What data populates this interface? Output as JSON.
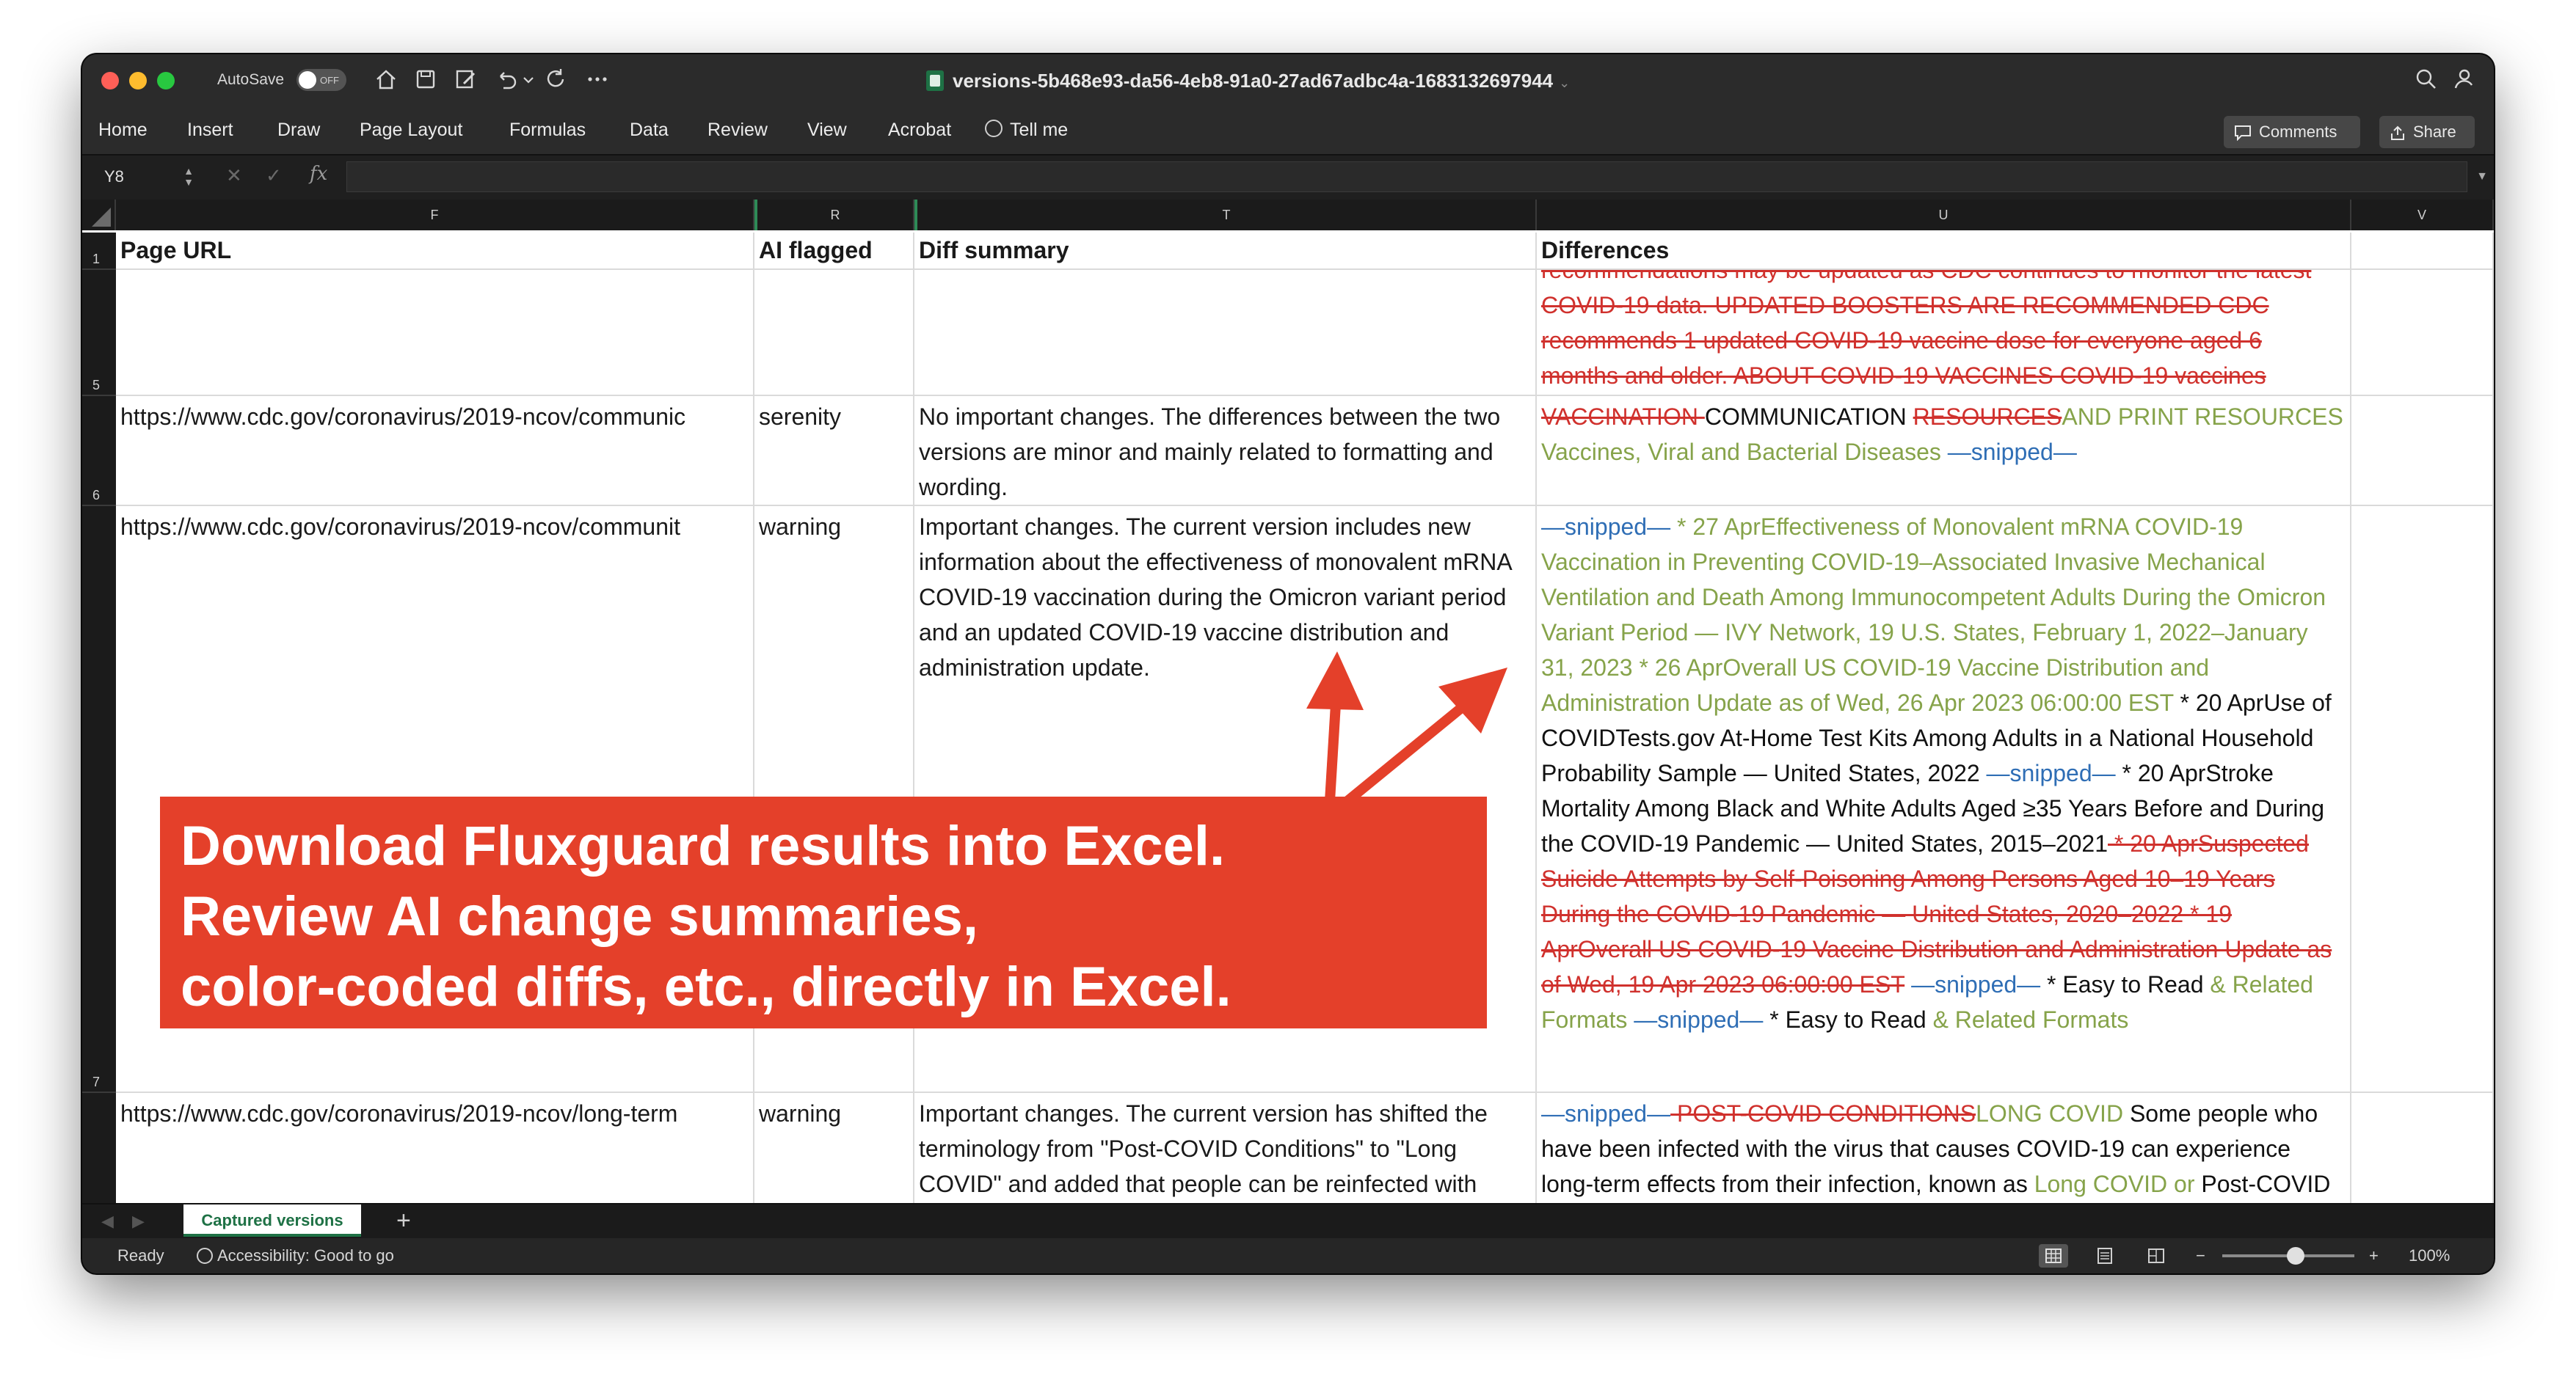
{
  "window": {
    "autosave_label": "AutoSave",
    "autosave_state": "OFF",
    "file_name": "versions-5b468e93-da56-4eb8-91a0-27ad67adbc4a-1683132697944"
  },
  "ribbon": {
    "tabs": [
      "Home",
      "Insert",
      "Draw",
      "Page Layout",
      "Formulas",
      "Data",
      "Review",
      "View",
      "Acrobat"
    ],
    "tell_me": "Tell me",
    "comments_label": "Comments",
    "share_label": "Share"
  },
  "formula_bar": {
    "cell_ref": "Y8",
    "fx_label": "fx",
    "value": ""
  },
  "columns": [
    "F",
    "R",
    "T",
    "U",
    "V"
  ],
  "rows_numbers": [
    "1",
    "5",
    "6",
    "7"
  ],
  "header_row": {
    "page_url": "Page URL",
    "ai_flagged": "AI flagged",
    "diff_summary": "Diff summary",
    "differences": "Differences"
  },
  "row5": {
    "lines": [
      "recommendations may be updated as CDC continues to monitor the latest",
      "COVID-19 data.  UPDATED BOOSTERS ARE RECOMMENDED  CDC",
      "recommends 1 updated COVID-19 vaccine dose for everyone aged 6",
      "months and older.  ABOUT COVID-19 VACCINES  COVID-19 vaccines"
    ]
  },
  "row6": {
    "url": "https://www.cdc.gov/coronavirus/2019-ncov/communic",
    "flag": "serenity",
    "summary": "No important changes. The differences between the two versions are minor and mainly related to formatting and wording.",
    "diff": {
      "d1": "VACCINATION ",
      "d2": "COMMUNICATION ",
      "d3": "RESOURCES",
      "d4": "AND PRINT RESOURCES",
      "d5": "Vaccines, Viral and Bacterial Diseases ",
      "d6": "—snipped—"
    }
  },
  "row7": {
    "url": "https://www.cdc.gov/coronavirus/2019-ncov/communit",
    "flag": "warning",
    "summary": "Important changes. The current version includes new information about the effectiveness of monovalent mRNA COVID-19 vaccination during the Omicron variant period and an updated COVID-19 vaccine distribution and administration update.",
    "diff": {
      "d1": "—snipped—",
      "d2": "  * 27 AprEffectiveness of Monovalent mRNA COVID-19 Vaccination in Preventing COVID-19–Associated Invasive Mechanical Ventilation and Death Among Immunocompetent Adults During the Omicron Variant Period — IVY Network, 19 U.S. States, February 1, 2022–January 31, 2023  * 26 AprOverall US COVID-19 Vaccine Distribution and Administration Update as of Wed, 26 Apr 2023 06:00:00 EST",
      "d3": "  * 20 AprUse of COVIDTests.gov At-Home Test Kits Among Adults in a National Household Probability Sample — United States, 2022 ",
      "d4": "—snipped—",
      "d5": "  * 20 AprStroke Mortality Among Black and White Adults Aged ≥35 Years Before and During the COVID-19 Pandemic — United States, 2015–2021",
      "d6": "  * 20 AprSuspected Suicide Attempts by Self-Poisoning Among Persons Aged 10–19 Years During the COVID-19 Pandemic — United States, 2020–2022  * 19 AprOverall US COVID-19 Vaccine Distribution and Administration Update as of Wed, 19 Apr 2023 06:00:00 EST",
      "d7": " —snipped—",
      "d8": "  * Easy to Read",
      "d9": " & Related Formats ",
      "d10": "—snipped—",
      "d11": "  * Easy to Read",
      "d12": " & Related Formats"
    }
  },
  "row8": {
    "url": "https://www.cdc.gov/coronavirus/2019-ncov/long-term",
    "flag": "warning",
    "summary": "Important changes. The current version has shifted the terminology from \"Post-COVID Conditions\" to \"Long COVID\" and added that people can be reinfected with",
    "diff": {
      "d1": "—snipped—",
      "d2": " POST-COVID CONDITIONS",
      "d3": "LONG COVID",
      "d4": "  Some people who have been infected with the virus that causes COVID-19 can experience long-term effects from their infection, known as ",
      "d5": "Long COVID or ",
      "d6": "Post-COVID"
    }
  },
  "annotation": {
    "line1": "Download Fluxguard results into Excel.",
    "line2": "Review AI change summaries,",
    "line3": "color-coded diffs, etc., directly in Excel."
  },
  "sheet": {
    "tab_label": "Captured versions",
    "add_symbol": "+"
  },
  "status": {
    "ready": "Ready",
    "accessibility": "Accessibility: Good to go",
    "zoom": "100%",
    "minus": "−",
    "plus": "+"
  },
  "colors": {
    "accent_excel_green": "#1e7145",
    "diff_added": "#86a34a",
    "diff_removed": "#d0312d",
    "diff_snipped": "#2f6eb5",
    "annotation": "#e4402a"
  }
}
